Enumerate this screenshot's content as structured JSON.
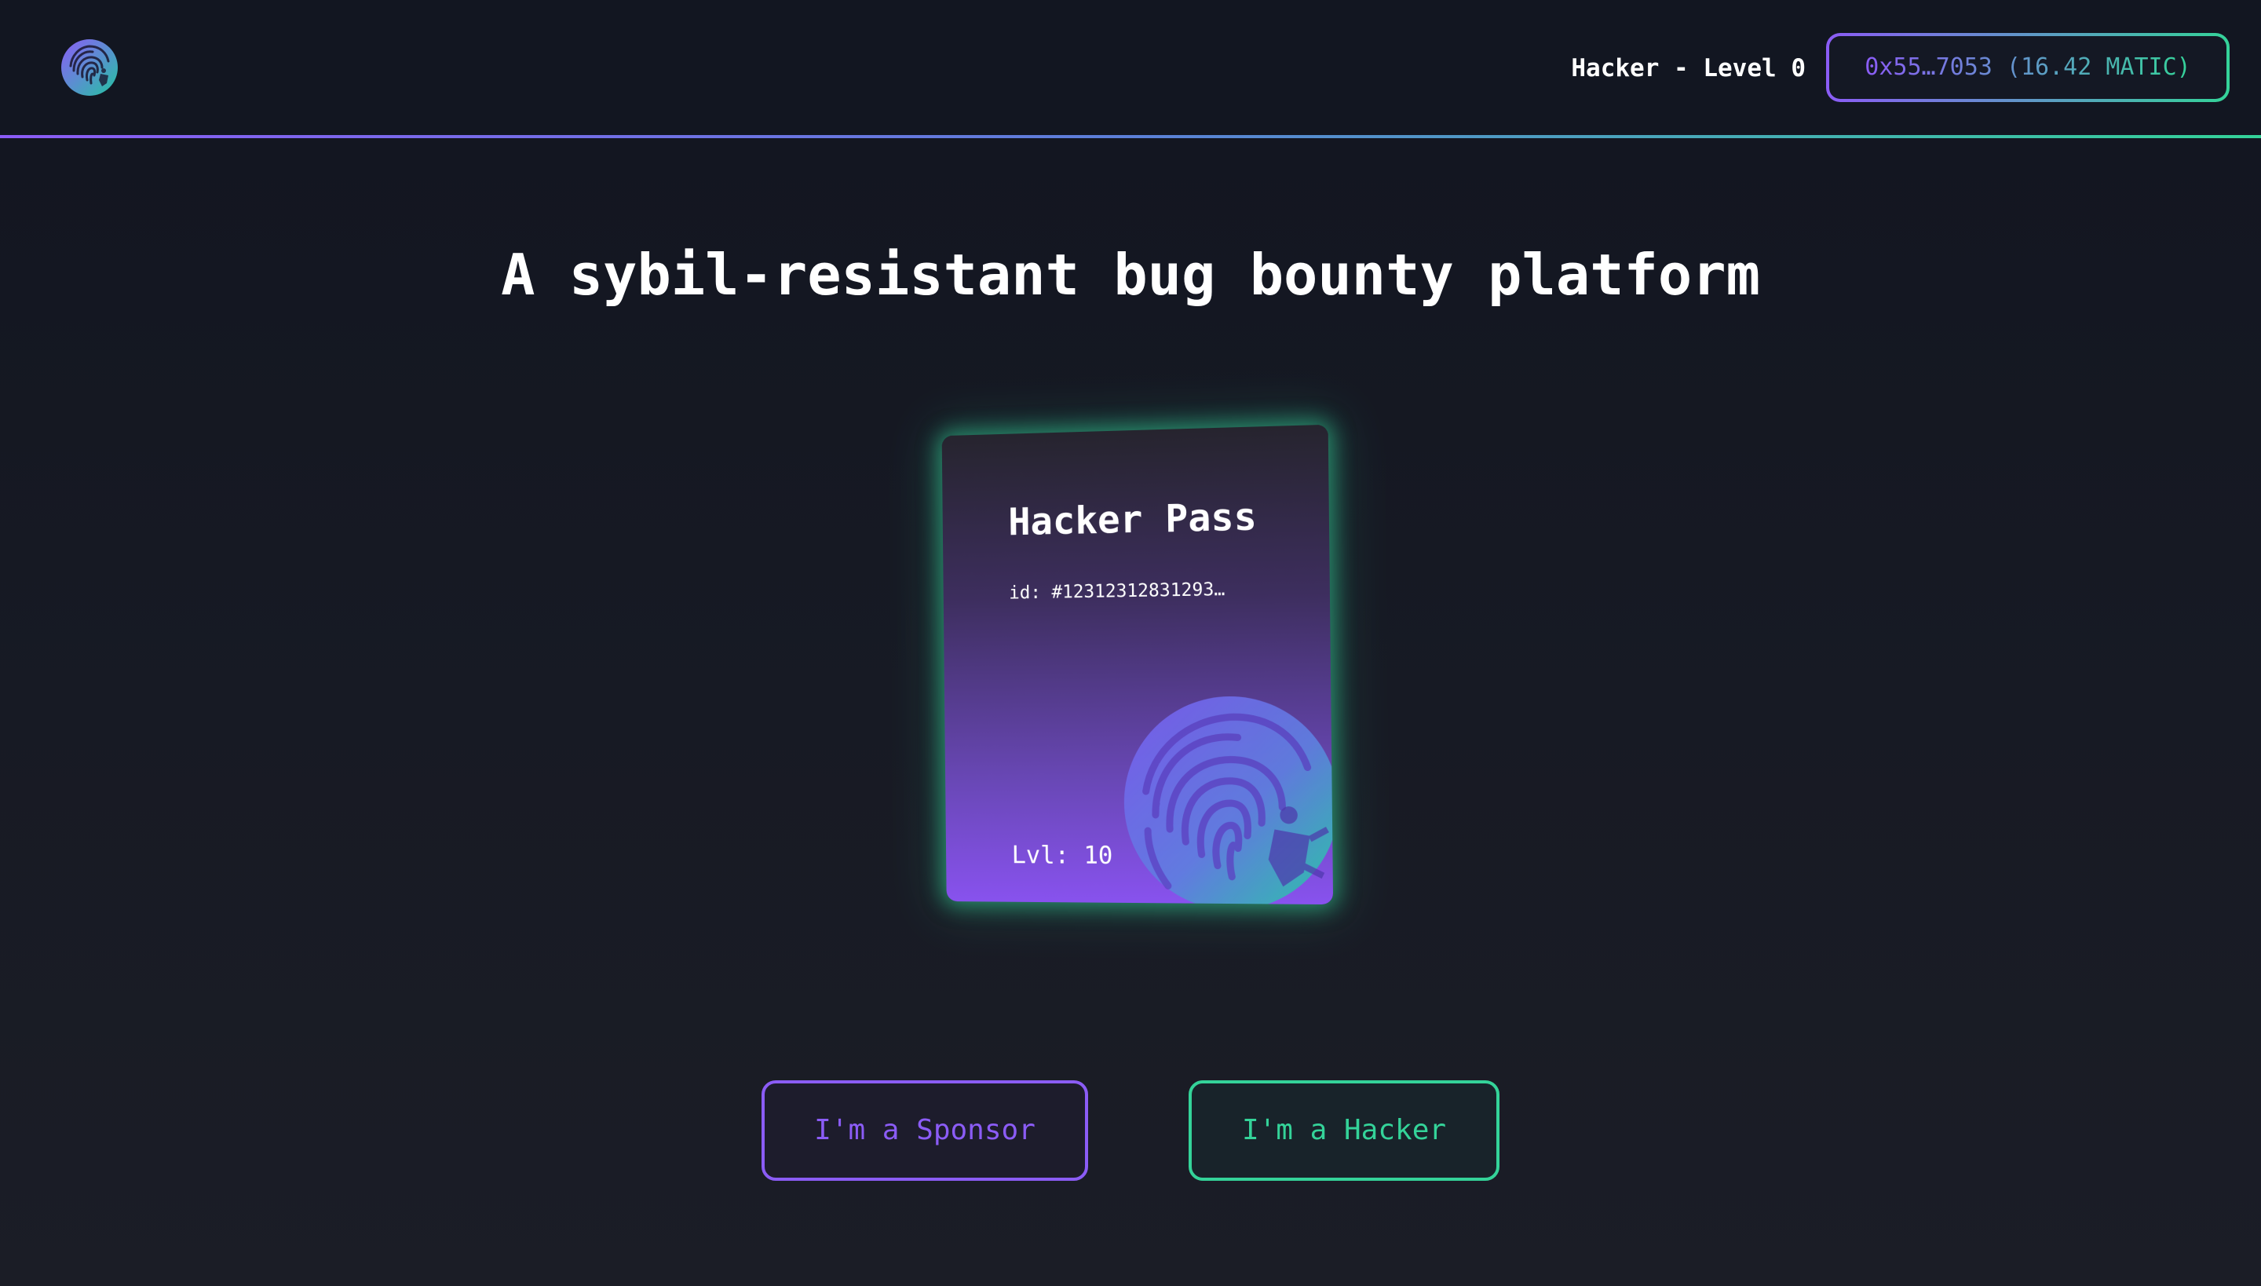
{
  "header": {
    "logo_icon": "fingerprint-bug-logo-icon",
    "user_level": "Hacker - Level 0",
    "wallet_label": "0x55…7053 (16.42 MATIC)"
  },
  "hero": {
    "headline": "A sybil-resistant bug bounty platform"
  },
  "pass_card": {
    "title": "Hacker Pass",
    "id_text": "id: #12312312831293…",
    "level_text": "Lvl: 10",
    "emblem_icon": "fingerprint-bug-icon"
  },
  "actions": {
    "sponsor_label": "I'm a Sponsor",
    "hacker_label": "I'm a Hacker"
  },
  "colors": {
    "accent_purple": "#8b5cf6",
    "accent_green": "#34d399",
    "background": "#161922"
  }
}
